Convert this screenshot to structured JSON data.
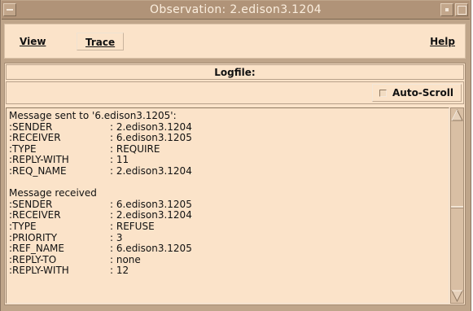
{
  "window": {
    "title": "Observation: 2.edison3.1204"
  },
  "menubar": {
    "view": "View",
    "trace": "Trace",
    "help": "Help"
  },
  "logfile": {
    "label": "Logfile:",
    "autoscroll_label": "Auto-Scroll",
    "autoscroll_checked": false,
    "lines": [
      {
        "type": "msg",
        "text": "Message sent to '6.edison3.1205':"
      },
      {
        "type": "kv",
        "key": ":SENDER",
        "value": ": 2.edison3.1204"
      },
      {
        "type": "kv",
        "key": ":RECEIVER",
        "value": ": 6.edison3.1205"
      },
      {
        "type": "kv",
        "key": ":TYPE",
        "value": ": REQUIRE"
      },
      {
        "type": "kv",
        "key": ":REPLY-WITH",
        "value": ": 11"
      },
      {
        "type": "kv",
        "key": ":REQ_NAME",
        "value": ": 2.edison3.1204"
      },
      {
        "type": "blank",
        "text": ""
      },
      {
        "type": "msg",
        "text": "Message received"
      },
      {
        "type": "kv",
        "key": ":SENDER",
        "value": ": 6.edison3.1205"
      },
      {
        "type": "kv",
        "key": ":RECEIVER",
        "value": ": 2.edison3.1204"
      },
      {
        "type": "kv",
        "key": ":TYPE",
        "value": ": REFUSE"
      },
      {
        "type": "kv",
        "key": ":PRIORITY",
        "value": ": 3"
      },
      {
        "type": "kv",
        "key": ":REF_NAME",
        "value": ": 6.edison3.1205"
      },
      {
        "type": "kv",
        "key": ":REPLY-TO",
        "value": ": none"
      },
      {
        "type": "kv",
        "key": ":REPLY-WITH",
        "value": ": 12"
      }
    ]
  },
  "colors": {
    "frame": "#bfa58a",
    "panel": "#fbe3c9",
    "title_text": "#fbeede"
  },
  "icons": {
    "window_menu": "dash-icon",
    "minimize": "minimize-icon",
    "maximize": "maximize-icon",
    "scroll_up": "arrow-up-icon",
    "scroll_down": "arrow-down-icon"
  }
}
